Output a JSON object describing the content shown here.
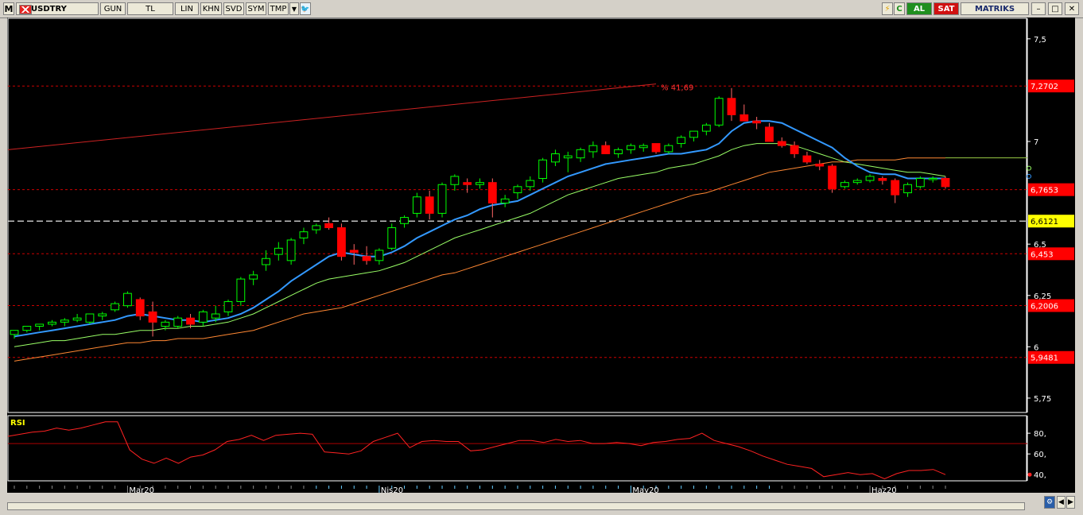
{
  "toolbar": {
    "menu_label": "M",
    "symbol": "USDTRY",
    "buttons": [
      "GUN",
      "TL",
      "LIN",
      "KHN",
      "SVD",
      "SYM",
      "TMP"
    ],
    "al_label": "AL",
    "sat_label": "SAT",
    "brand": "MATRIKS"
  },
  "colors": {
    "background": "#000000",
    "up_candle": "#00ff00",
    "down_candle": "#ff0000",
    "ma_fast": "#3399ff",
    "ma_mid": "#99ff66",
    "ma_slow": "#ff8833",
    "level_line": "#cc0000",
    "price_box": "#ff0000",
    "current_box": "#ffff00"
  },
  "chart_data": [
    {
      "type": "candlestick",
      "y_axis": {
        "ticks": [
          "7,5",
          "7",
          "6,5",
          "6,25",
          "6",
          "5,75"
        ],
        "tick_values": [
          7.5,
          7.0,
          6.5,
          6.25,
          6.0,
          5.75
        ],
        "range": [
          5.68,
          7.6
        ]
      },
      "x_axis": {
        "labels": [
          "Mar20",
          "Nis20",
          "May20",
          "Haz20"
        ],
        "label_index": [
          9,
          29,
          49,
          68
        ]
      },
      "levels": [
        {
          "label": "7,2702",
          "value": 7.2702
        },
        {
          "label": "6,7653",
          "value": 6.7653
        },
        {
          "label": "6,453",
          "value": 6.453
        },
        {
          "label": "6,2006",
          "value": 6.2006
        },
        {
          "label": "5,9481",
          "value": 5.9481
        }
      ],
      "current": {
        "label": "6,6121",
        "value": 6.6121
      },
      "annotation": "% 41,69",
      "trendline": {
        "from": [
          0,
          6.96
        ],
        "to": [
          51,
          7.28
        ]
      },
      "candles": [
        [
          6.06,
          6.08,
          6.04,
          6.08
        ],
        [
          6.08,
          6.1,
          6.07,
          6.1
        ],
        [
          6.1,
          6.11,
          6.08,
          6.11
        ],
        [
          6.11,
          6.13,
          6.1,
          6.12
        ],
        [
          6.12,
          6.14,
          6.1,
          6.13
        ],
        [
          6.13,
          6.16,
          6.12,
          6.14
        ],
        [
          6.12,
          6.16,
          6.11,
          6.16
        ],
        [
          6.15,
          6.17,
          6.13,
          6.16
        ],
        [
          6.18,
          6.22,
          6.17,
          6.21
        ],
        [
          6.2,
          6.27,
          6.19,
          6.26
        ],
        [
          6.23,
          6.24,
          6.13,
          6.15
        ],
        [
          6.17,
          6.22,
          6.05,
          6.12
        ],
        [
          6.1,
          6.13,
          6.08,
          6.12
        ],
        [
          6.1,
          6.15,
          6.09,
          6.14
        ],
        [
          6.14,
          6.16,
          6.09,
          6.11
        ],
        [
          6.12,
          6.18,
          6.1,
          6.17
        ],
        [
          6.14,
          6.2,
          6.12,
          6.16
        ],
        [
          6.17,
          6.23,
          6.15,
          6.22
        ],
        [
          6.22,
          6.34,
          6.2,
          6.33
        ],
        [
          6.33,
          6.37,
          6.3,
          6.35
        ],
        [
          6.4,
          6.47,
          6.37,
          6.43
        ],
        [
          6.45,
          6.51,
          6.42,
          6.48
        ],
        [
          6.42,
          6.53,
          6.4,
          6.52
        ],
        [
          6.53,
          6.58,
          6.5,
          6.56
        ],
        [
          6.57,
          6.6,
          6.55,
          6.59
        ],
        [
          6.6,
          6.63,
          6.57,
          6.58
        ],
        [
          6.58,
          6.6,
          6.42,
          6.44
        ],
        [
          6.47,
          6.5,
          6.4,
          6.46
        ],
        [
          6.44,
          6.49,
          6.4,
          6.42
        ],
        [
          6.42,
          6.48,
          6.4,
          6.47
        ],
        [
          6.48,
          6.6,
          6.47,
          6.58
        ],
        [
          6.6,
          6.64,
          6.58,
          6.63
        ],
        [
          6.65,
          6.75,
          6.63,
          6.73
        ],
        [
          6.73,
          6.76,
          6.62,
          6.65
        ],
        [
          6.65,
          6.8,
          6.63,
          6.79
        ],
        [
          6.79,
          6.84,
          6.76,
          6.83
        ],
        [
          6.8,
          6.82,
          6.75,
          6.79
        ],
        [
          6.79,
          6.82,
          6.77,
          6.8
        ],
        [
          6.8,
          6.82,
          6.63,
          6.7
        ],
        [
          6.7,
          6.74,
          6.68,
          6.72
        ],
        [
          6.75,
          6.79,
          6.72,
          6.78
        ],
        [
          6.78,
          6.83,
          6.76,
          6.81
        ],
        [
          6.82,
          6.92,
          6.8,
          6.91
        ],
        [
          6.9,
          6.96,
          6.88,
          6.94
        ],
        [
          6.92,
          6.95,
          6.85,
          6.93
        ],
        [
          6.92,
          6.97,
          6.9,
          6.96
        ],
        [
          6.95,
          7.0,
          6.92,
          6.98
        ],
        [
          6.98,
          7.0,
          6.95,
          6.94
        ],
        [
          6.94,
          6.97,
          6.92,
          6.96
        ],
        [
          6.96,
          6.99,
          6.94,
          6.98
        ],
        [
          6.97,
          6.99,
          6.95,
          6.98
        ],
        [
          6.99,
          6.99,
          6.94,
          6.95
        ],
        [
          6.95,
          6.99,
          6.94,
          6.98
        ],
        [
          6.99,
          7.03,
          6.97,
          7.02
        ],
        [
          7.02,
          7.05,
          7.0,
          7.05
        ],
        [
          7.05,
          7.09,
          7.03,
          7.08
        ],
        [
          7.08,
          7.22,
          7.07,
          7.21
        ],
        [
          7.21,
          7.26,
          7.1,
          7.13
        ],
        [
          7.13,
          7.18,
          7.1,
          7.1
        ],
        [
          7.1,
          7.12,
          7.06,
          7.09
        ],
        [
          7.07,
          7.09,
          7.0,
          7.0
        ],
        [
          7.0,
          7.02,
          6.97,
          6.98
        ],
        [
          6.98,
          7.0,
          6.92,
          6.94
        ],
        [
          6.93,
          6.95,
          6.89,
          6.9
        ],
        [
          6.89,
          6.91,
          6.86,
          6.88
        ],
        [
          6.88,
          6.89,
          6.75,
          6.77
        ],
        [
          6.78,
          6.81,
          6.77,
          6.8
        ],
        [
          6.8,
          6.82,
          6.79,
          6.81
        ],
        [
          6.81,
          6.84,
          6.8,
          6.83
        ],
        [
          6.82,
          6.83,
          6.79,
          6.81
        ],
        [
          6.81,
          6.82,
          6.7,
          6.74
        ],
        [
          6.75,
          6.8,
          6.73,
          6.79
        ],
        [
          6.78,
          6.83,
          6.77,
          6.82
        ],
        [
          6.82,
          6.83,
          6.8,
          6.82
        ],
        [
          6.82,
          6.83,
          6.77,
          6.78
        ]
      ],
      "ma_fast": [
        6.05,
        6.06,
        6.07,
        6.08,
        6.09,
        6.1,
        6.11,
        6.12,
        6.13,
        6.15,
        6.16,
        6.15,
        6.14,
        6.13,
        6.13,
        6.12,
        6.13,
        6.14,
        6.16,
        6.19,
        6.23,
        6.27,
        6.32,
        6.36,
        6.4,
        6.44,
        6.46,
        6.45,
        6.44,
        6.44,
        6.46,
        6.49,
        6.53,
        6.56,
        6.59,
        6.62,
        6.64,
        6.67,
        6.69,
        6.7,
        6.71,
        6.74,
        6.77,
        6.8,
        6.83,
        6.85,
        6.87,
        6.89,
        6.9,
        6.91,
        6.92,
        6.93,
        6.94,
        6.94,
        6.95,
        6.96,
        6.99,
        7.05,
        7.09,
        7.1,
        7.1,
        7.09,
        7.06,
        7.03,
        7.0,
        6.97,
        6.92,
        6.88,
        6.85,
        6.84,
        6.84,
        6.82,
        6.82,
        6.82,
        6.82
      ],
      "ma_mid": [
        6.0,
        6.01,
        6.02,
        6.03,
        6.03,
        6.04,
        6.05,
        6.06,
        6.06,
        6.07,
        6.08,
        6.08,
        6.09,
        6.09,
        6.1,
        6.1,
        6.11,
        6.12,
        6.14,
        6.16,
        6.19,
        6.22,
        6.25,
        6.28,
        6.31,
        6.33,
        6.34,
        6.35,
        6.36,
        6.37,
        6.39,
        6.41,
        6.44,
        6.47,
        6.5,
        6.53,
        6.55,
        6.57,
        6.59,
        6.61,
        6.63,
        6.65,
        6.68,
        6.71,
        6.74,
        6.76,
        6.78,
        6.8,
        6.82,
        6.83,
        6.84,
        6.85,
        6.87,
        6.88,
        6.89,
        6.91,
        6.93,
        6.96,
        6.98,
        6.99,
        6.99,
        6.99,
        6.98,
        6.96,
        6.94,
        6.92,
        6.9,
        6.89,
        6.88,
        6.87,
        6.86,
        6.85,
        6.85,
        6.84,
        6.83
      ],
      "ma_slow": [
        5.93,
        5.94,
        5.95,
        5.96,
        5.97,
        5.98,
        5.99,
        6.0,
        6.01,
        6.02,
        6.02,
        6.03,
        6.03,
        6.04,
        6.04,
        6.04,
        6.05,
        6.06,
        6.07,
        6.08,
        6.1,
        6.12,
        6.14,
        6.16,
        6.17,
        6.18,
        6.19,
        6.21,
        6.23,
        6.25,
        6.27,
        6.29,
        6.31,
        6.33,
        6.35,
        6.36,
        6.38,
        6.4,
        6.42,
        6.44,
        6.46,
        6.48,
        6.5,
        6.52,
        6.54,
        6.56,
        6.58,
        6.6,
        6.62,
        6.64,
        6.66,
        6.68,
        6.7,
        6.72,
        6.74,
        6.75,
        6.77,
        6.79,
        6.81,
        6.83,
        6.85,
        6.86,
        6.87,
        6.88,
        6.89,
        6.9,
        6.9,
        6.91,
        6.91,
        6.91,
        6.91,
        6.92,
        6.92,
        6.92,
        6.92
      ]
    },
    {
      "type": "line",
      "title": "RSI",
      "y_axis": {
        "ticks": [
          "80,",
          "60,",
          "40,"
        ],
        "tick_values": [
          80,
          60,
          40
        ],
        "range": [
          34,
          97
        ]
      },
      "reference_line": 70,
      "values": [
        77,
        79,
        81,
        82,
        85,
        83,
        85,
        88,
        91,
        91,
        64,
        55,
        51,
        56,
        51,
        57,
        59,
        64,
        72,
        74,
        78,
        73,
        78,
        79,
        80,
        79,
        62,
        61,
        60,
        63,
        72,
        76,
        80,
        66,
        72,
        73,
        72,
        72,
        63,
        64,
        67,
        70,
        73,
        73,
        71,
        74,
        72,
        73,
        70,
        70,
        71,
        70,
        68,
        71,
        72,
        74,
        75,
        80,
        73,
        70,
        67,
        63,
        58,
        54,
        50,
        48,
        46,
        38,
        40,
        42,
        40,
        41,
        36,
        41,
        44,
        44,
        45,
        40
      ],
      "last_label": "40,"
    }
  ]
}
